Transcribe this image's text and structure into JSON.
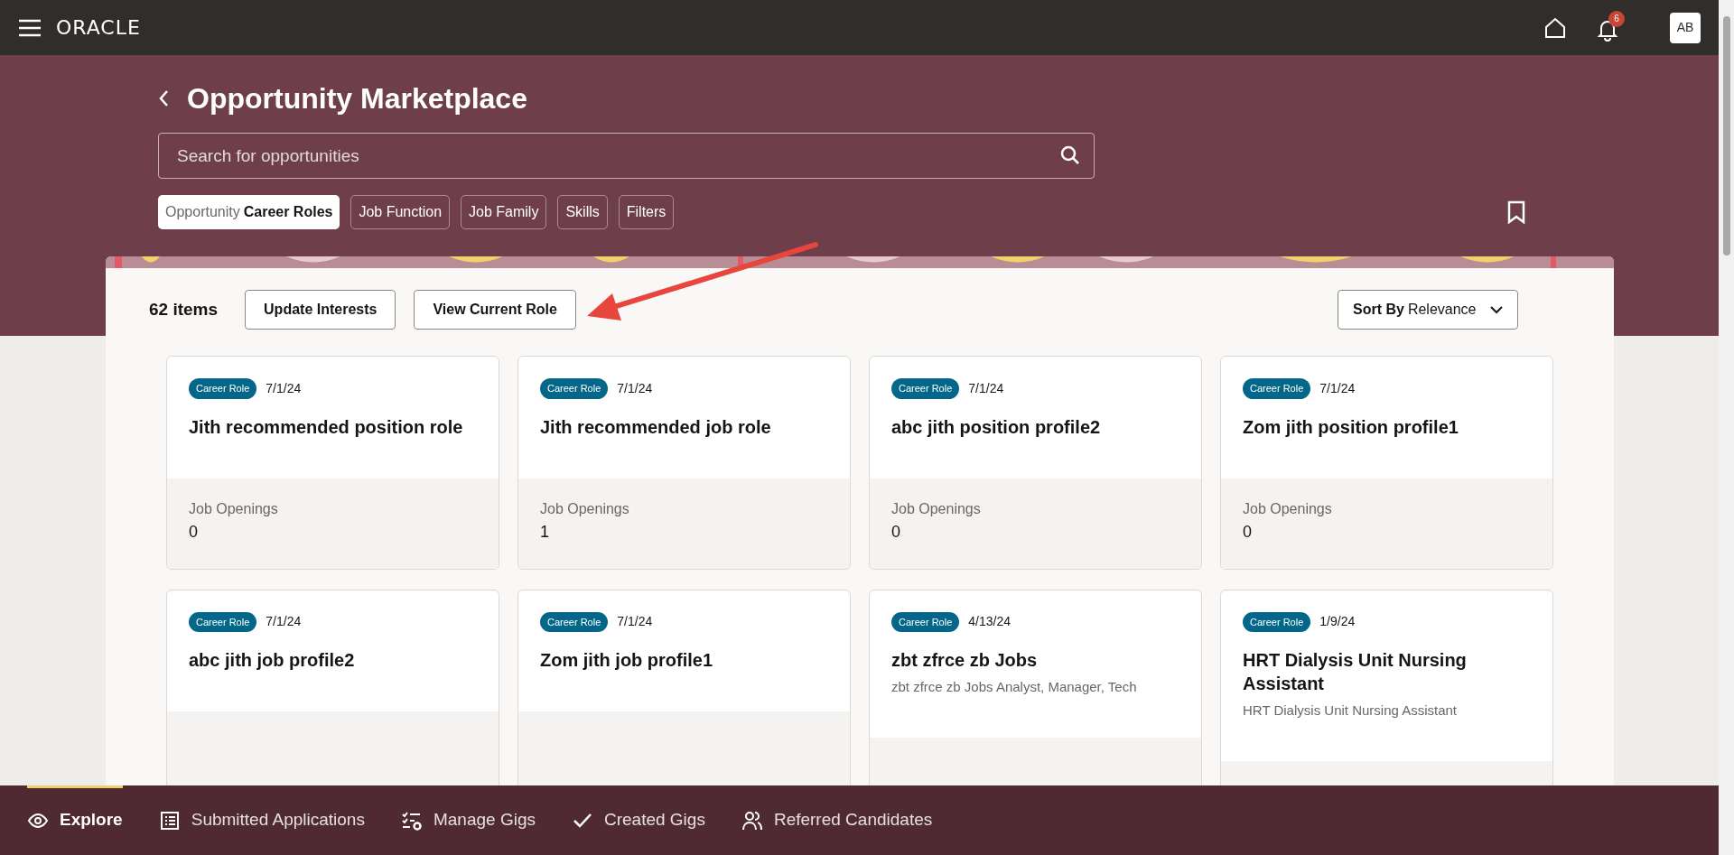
{
  "top_bar": {
    "logo": "ORACLE",
    "notification_count": "6",
    "avatar": "AB"
  },
  "header": {
    "title": "Opportunity Marketplace",
    "search": {
      "placeholder": "Search for opportunities"
    },
    "chips": [
      {
        "prefix": "Opportunity",
        "label": "Career Roles",
        "selected": true
      },
      {
        "label": "Job Function",
        "selected": false
      },
      {
        "label": "Job Family",
        "selected": false
      },
      {
        "label": "Skills",
        "selected": false
      },
      {
        "label": "Filters",
        "selected": false
      }
    ]
  },
  "toolbar": {
    "count": "62 items",
    "buttons": [
      "Update Interests",
      "View Current Role"
    ],
    "sort": {
      "label": "Sort By",
      "value": "Relevance"
    }
  },
  "cards": [
    {
      "tag": "Career Role",
      "date": "7/1/24",
      "title": "Jith recommended position role",
      "openings_label": "Job Openings",
      "openings": "0"
    },
    {
      "tag": "Career Role",
      "date": "7/1/24",
      "title": "Jith recommended job role",
      "openings_label": "Job Openings",
      "openings": "1"
    },
    {
      "tag": "Career Role",
      "date": "7/1/24",
      "title": "abc jith position profile2",
      "openings_label": "Job Openings",
      "openings": "0"
    },
    {
      "tag": "Career Role",
      "date": "7/1/24",
      "title": "Zom jith position profile1",
      "openings_label": "Job Openings",
      "openings": "0"
    },
    {
      "tag": "Career Role",
      "date": "7/1/24",
      "title": "abc jith job profile2"
    },
    {
      "tag": "Career Role",
      "date": "7/1/24",
      "title": "Zom jith job profile1"
    },
    {
      "tag": "Career Role",
      "date": "4/13/24",
      "title": "zbt zfrce zb Jobs",
      "subtitle": "zbt zfrce zb Jobs Analyst, Manager, Tech"
    },
    {
      "tag": "Career Role",
      "date": "1/9/24",
      "title": "HRT Dialysis Unit Nursing Assistant",
      "subtitle": "HRT Dialysis Unit Nursing Assistant"
    }
  ],
  "bottom_nav": [
    {
      "kind": "eye",
      "label": "Explore",
      "selected": true
    },
    {
      "kind": "list",
      "label": "Submitted Applications",
      "selected": false
    },
    {
      "kind": "gear",
      "label": "Manage Gigs",
      "selected": false
    },
    {
      "kind": "check",
      "label": "Created Gigs",
      "selected": false
    },
    {
      "kind": "people",
      "label": "Referred Candidates",
      "selected": false
    }
  ]
}
